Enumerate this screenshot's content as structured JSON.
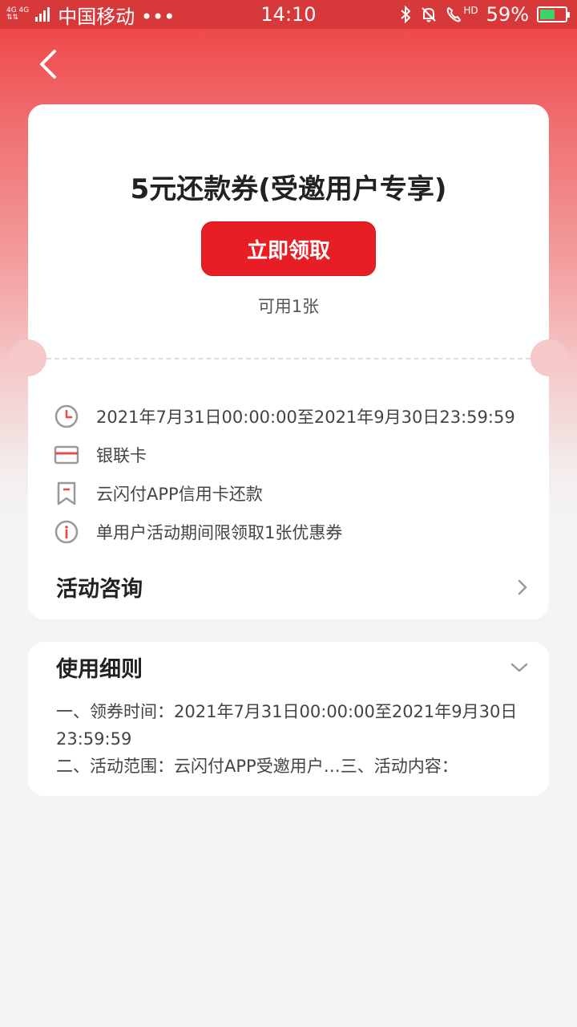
{
  "status_bar": {
    "net_top": "4G 4G",
    "carrier": "中国移动 •••",
    "time": "14:10",
    "hd": "HD",
    "battery": "59%",
    "battery_level": 59
  },
  "coupon": {
    "title": "5元还款券(受邀用户专享)",
    "claim_label": "立即领取",
    "available": "可用1张"
  },
  "details": [
    {
      "icon": "clock-icon",
      "text": "2021年7月31日00:00:00至2021年9月30日23:59:59"
    },
    {
      "icon": "card-icon",
      "text": "银联卡"
    },
    {
      "icon": "bookmark-icon",
      "text": "云闪付APP信用卡还款"
    },
    {
      "icon": "info-icon",
      "text": "单用户活动期间限领取1张优惠券"
    }
  ],
  "consult": {
    "label": "活动咨询"
  },
  "rules": {
    "title": "使用细则",
    "lines": [
      "一、领券时间：2021年7月31日00:00:00至2021年9月30日",
      "23:59:59",
      "二、活动范围：云闪付APP受邀用户…三、活动内容："
    ]
  },
  "colors": {
    "accent": "#e81e27",
    "header_top": "#ef3d3f"
  }
}
